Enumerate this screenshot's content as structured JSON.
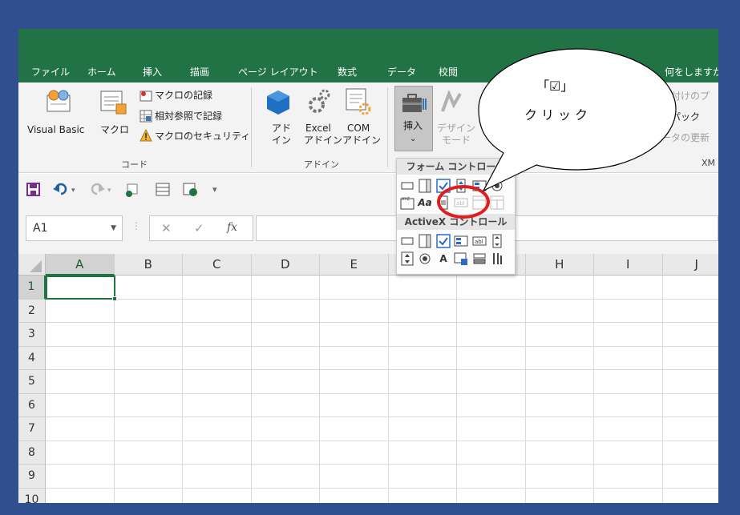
{
  "ribbon_tabs": [
    "ファイル",
    "ホーム",
    "挿入",
    "描画",
    "ページ レイアウト",
    "数式",
    "データ",
    "校閲",
    "何をしますか"
  ],
  "code_group": {
    "visual_basic": "Visual Basic",
    "macro": "マクロ",
    "record_macro": "マクロの記録",
    "relative_ref": "相対参照で記録",
    "macro_security": "マクロのセキュリティ",
    "label": "コード"
  },
  "addins_group": {
    "addins_line1": "アド",
    "addins_line2": "イン",
    "excel_line1": "Excel",
    "excel_line2": "アドイン",
    "com_line1": "COM",
    "com_line2": "アドイン",
    "label": "アドイン"
  },
  "controls_group": {
    "insert": "挿入",
    "insert_arrow": "⌄",
    "design_line1": "デザイン",
    "design_line2": "モード"
  },
  "xml_group": {
    "map_props": "対応付けのプ",
    "expansion_packs": "拡張パック",
    "refresh_data": "データの更新",
    "label": "XM"
  },
  "name_box": {
    "value": "A1"
  },
  "formula_buttons": {
    "cancel": "✕",
    "enter": "✓",
    "fx": "fx"
  },
  "columns": [
    "A",
    "B",
    "C",
    "D",
    "E",
    "F",
    "G",
    "H",
    "I",
    "J"
  ],
  "rows": [
    "1",
    "2",
    "3",
    "4",
    "5",
    "6",
    "7",
    "8",
    "9",
    "10"
  ],
  "dropdown": {
    "form_controls_title": "フォーム コントロール",
    "activex_title": "ActiveX コントロール",
    "aa": "Aa",
    "label_a": "A",
    "xyz": "XYZ",
    "abl": "abl"
  },
  "callout": {
    "line1": "「☑」",
    "line2": "クリック"
  },
  "colors": {
    "excel_green": "#217346",
    "border_blue": "#2f4f8f",
    "highlight_red": "#e21b1b"
  }
}
